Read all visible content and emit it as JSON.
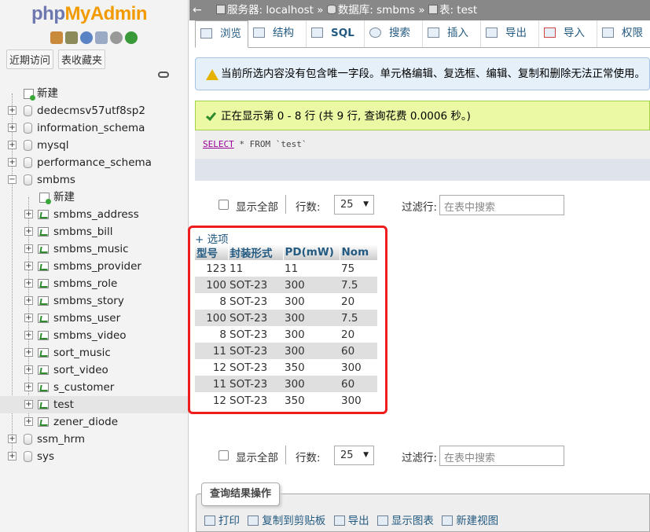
{
  "logo": {
    "part1": "php",
    "part2": "MyAdmin"
  },
  "nav": {
    "tab_recent": "近期访问",
    "tab_favorites": "表收藏夹",
    "new_label": "新建",
    "databases": [
      "dedecmsv57utf8sp2",
      "information_schema",
      "mysql",
      "performance_schema",
      "smbms"
    ],
    "smbms_new": "新建",
    "tables": [
      "smbms_address",
      "smbms_bill",
      "smbms_music",
      "smbms_provider",
      "smbms_role",
      "smbms_story",
      "smbms_user",
      "smbms_video",
      "sort_music",
      "sort_video",
      "s_customer",
      "test",
      "zener_diode"
    ],
    "selected_table": "test",
    "more_databases": [
      "ssm_hrm",
      "sys"
    ]
  },
  "breadcrumb": {
    "server": "服务器: localhost",
    "sep1": "»",
    "database": "数据库: smbms",
    "sep2": "»",
    "table": "表: test"
  },
  "tabs": [
    "浏览",
    "结构",
    "SQL",
    "搜索",
    "插入",
    "导出",
    "导入",
    "权限"
  ],
  "active_tab": "浏览",
  "notice_warning": "当前所选内容没有包含唯一字段。单元格编辑、复选框、编辑、复制和删除无法正常使用。",
  "notice_success": "正在显示第 0 - 8 行 (共 9 行, 查询花费 0.0006 秒。)",
  "sql": {
    "keyword": "SELECT",
    "rest": " * FROM `test`"
  },
  "controls": {
    "show_all": "显示全部",
    "rows_label": "行数:",
    "rows_value": "25",
    "filter_label": "过滤行:",
    "filter_placeholder": "在表中搜索"
  },
  "options_link": "+ 选项",
  "table": {
    "columns": [
      "型号",
      "封装形式",
      "PD(mW)",
      "Nom"
    ],
    "rows": [
      [
        "123",
        "11",
        "11",
        "75"
      ],
      [
        "100",
        "SOT-23",
        "300",
        "7.5"
      ],
      [
        "8",
        "SOT-23",
        "300",
        "20"
      ],
      [
        "100",
        "SOT-23",
        "300",
        "7.5"
      ],
      [
        "8",
        "SOT-23",
        "300",
        "20"
      ],
      [
        "11",
        "SOT-23",
        "300",
        "60"
      ],
      [
        "12",
        "SOT-23",
        "350",
        "300"
      ],
      [
        "11",
        "SOT-23",
        "300",
        "60"
      ],
      [
        "12",
        "SOT-23",
        "350",
        "300"
      ]
    ]
  },
  "query_ops": {
    "legend": "查询结果操作",
    "links": [
      "打印",
      "复制到剪贴板",
      "导出",
      "显示图表",
      "新建视图"
    ]
  },
  "colors": {
    "accent_link": "#235a81",
    "highlight": "#ee1c1c",
    "topbar": "#888888"
  }
}
